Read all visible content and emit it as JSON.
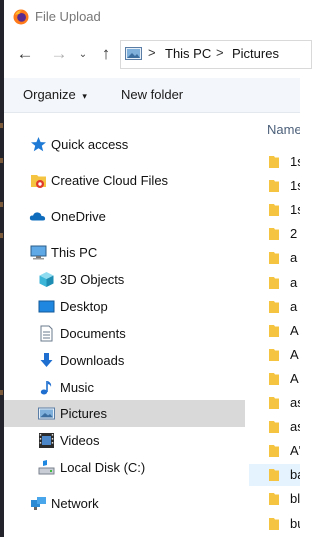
{
  "window": {
    "title": "File Upload"
  },
  "address_bar": {
    "breadcrumbs": [
      "This PC",
      "Pictures"
    ],
    "separator": ">"
  },
  "nav_buttons": {
    "back": "←",
    "forward": "→",
    "recent": "⌄",
    "up": "↑"
  },
  "toolbar": {
    "organize_label": "Organize",
    "organize_caret": "▾",
    "new_folder_label": "New folder"
  },
  "nav_pane": {
    "items": [
      {
        "label": "Quick access",
        "icon": "star-icon"
      },
      {
        "label": "Creative Cloud Files",
        "icon": "creative-cloud-folder-icon"
      },
      {
        "label": "OneDrive",
        "icon": "cloud-icon"
      },
      {
        "label": "This PC",
        "icon": "computer-icon"
      },
      {
        "label": "3D Objects",
        "icon": "cube-icon"
      },
      {
        "label": "Desktop",
        "icon": "desktop-icon"
      },
      {
        "label": "Documents",
        "icon": "document-icon"
      },
      {
        "label": "Downloads",
        "icon": "download-icon"
      },
      {
        "label": "Music",
        "icon": "music-icon"
      },
      {
        "label": "Pictures",
        "icon": "pictures-icon",
        "selected": true
      },
      {
        "label": "Videos",
        "icon": "film-icon"
      },
      {
        "label": "Local Disk (C:)",
        "icon": "disk-icon"
      },
      {
        "label": "Network",
        "icon": "network-icon"
      }
    ]
  },
  "file_list": {
    "column_header": "Name",
    "rows": [
      "1s",
      "1s",
      "1s",
      "2",
      "a",
      "a",
      "a",
      "A",
      "A",
      "A",
      "as",
      "as",
      "A'",
      "ba",
      "bl",
      "bu"
    ]
  },
  "colors": {
    "selection": "#d9d9d9",
    "folder": "#f5c542",
    "accent": "#0078d7"
  }
}
